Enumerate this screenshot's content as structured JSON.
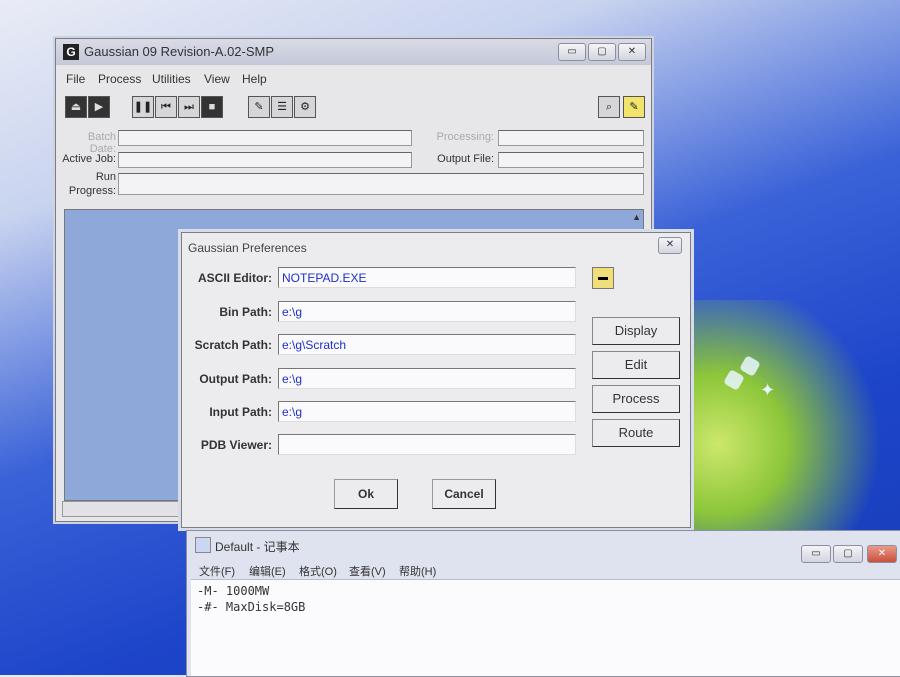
{
  "gaussian_window": {
    "title": "Gaussian 09 Revision-A.02-SMP",
    "icon_letter": "G",
    "menus": [
      "File",
      "Process",
      "Utilities",
      "View",
      "Help"
    ],
    "labels": {
      "batch_date": "Batch Date:",
      "active_job": "Active Job:",
      "run_progress_line1": "Run",
      "run_progress_line2": "Progress:",
      "processing": "Processing:",
      "output_file": "Output File:"
    }
  },
  "preferences_dialog": {
    "title": "Gaussian Preferences",
    "fields": [
      {
        "label": "ASCII Editor:",
        "value": "NOTEPAD.EXE"
      },
      {
        "label": "Bin Path:",
        "value": "e:\\g"
      },
      {
        "label": "Scratch Path:",
        "value": "e:\\g\\Scratch"
      },
      {
        "label": "Output Path:",
        "value": "e:\\g"
      },
      {
        "label": "Input Path:",
        "value": "e:\\g"
      },
      {
        "label": "PDB Viewer:",
        "value": ""
      }
    ],
    "side_buttons": [
      "Display",
      "Edit",
      "Process",
      "Route"
    ],
    "ok_label": "Ok",
    "cancel_label": "Cancel"
  },
  "notepad_window": {
    "title": "Default - 记事本",
    "menus": [
      "文件(F)",
      "编辑(E)",
      "格式(O)",
      "查看(V)",
      "帮助(H)"
    ],
    "lines": [
      "-M- 1000MW",
      "-#- MaxDisk=8GB"
    ]
  },
  "colors": {
    "field_text": "#1c30c9",
    "desktop_blue": "#1d45c9"
  }
}
